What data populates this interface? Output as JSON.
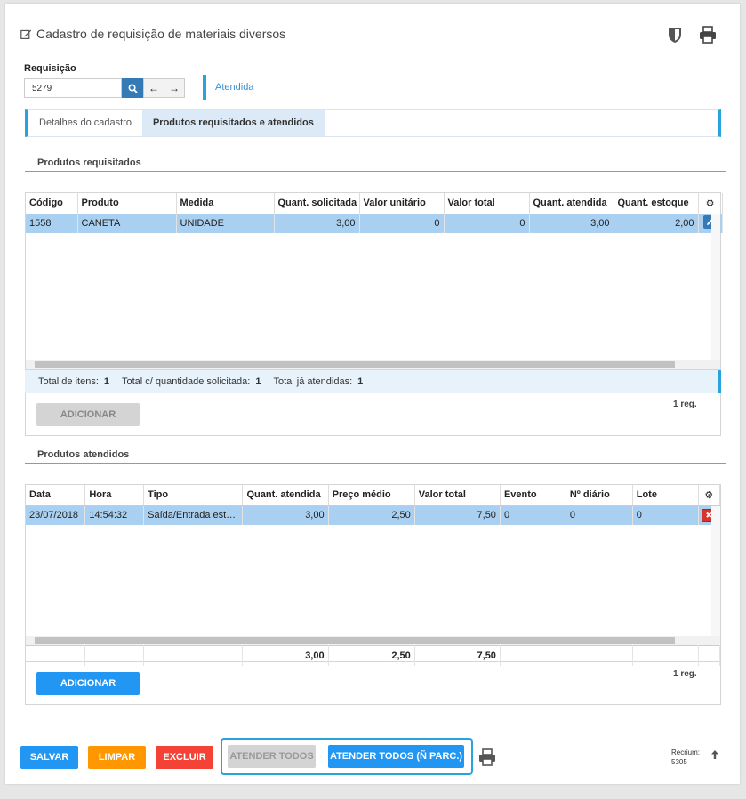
{
  "page": {
    "title": "Cadastro de requisição de materiais diversos",
    "requisicao_label": "Requisição",
    "requisicao_value": "5279",
    "status": "Atendida"
  },
  "tabs": [
    {
      "label": "Detalhes do cadastro"
    },
    {
      "label": "Produtos requisitados e atendidos"
    }
  ],
  "requisitados": {
    "section_title": "Produtos requisitados",
    "columns": [
      "Código",
      "Produto",
      "Medida",
      "Quant. solicitada",
      "Valor unitário",
      "Valor total",
      "Quant. atendida",
      "Quant. estoque"
    ],
    "rows": [
      [
        "1558",
        "CANETA",
        "UNIDADE",
        "3,00",
        "0",
        "0",
        "3,00",
        "2,00"
      ]
    ],
    "totals": {
      "total_itens_label": "Total de itens:",
      "total_itens_value": "1",
      "total_qtd_label": "Total c/ quantidade solicitada:",
      "total_qtd_value": "1",
      "total_atendidas_label": "Total já atendidas:",
      "total_atendidas_value": "1"
    },
    "add_button": "ADICIONAR",
    "reg_count": "1 reg."
  },
  "atendidos": {
    "section_title": "Produtos atendidos",
    "columns": [
      "Data",
      "Hora",
      "Tipo",
      "Quant. atendida",
      "Preço médio",
      "Valor total",
      "Evento",
      "Nº diário",
      "Lote"
    ],
    "rows": [
      [
        "23/07/2018",
        "14:54:32",
        "Saída/Entrada estoque",
        "3,00",
        "2,50",
        "7,50",
        "0",
        "0",
        "0"
      ]
    ],
    "footer_totals": [
      "",
      "",
      "",
      "3,00",
      "2,50",
      "7,50",
      "",
      "",
      ""
    ],
    "add_button": "ADICIONAR",
    "reg_count": "1 reg."
  },
  "actions": {
    "salvar": "SALVAR",
    "limpar": "LIMPAR",
    "excluir": "EXCLUIR",
    "atender_todos": "ATENDER TODOS",
    "atender_todos_parc": "ATENDER TODOS (Ñ PARC.)"
  },
  "footer": {
    "recrium_label": "Recrium:",
    "recrium_value": "5305"
  },
  "colors": {
    "accent": "#29a3dc",
    "primary": "#2196f3",
    "selected_row": "#a9d0f0",
    "orange": "#ff9800",
    "red": "#f44336"
  }
}
